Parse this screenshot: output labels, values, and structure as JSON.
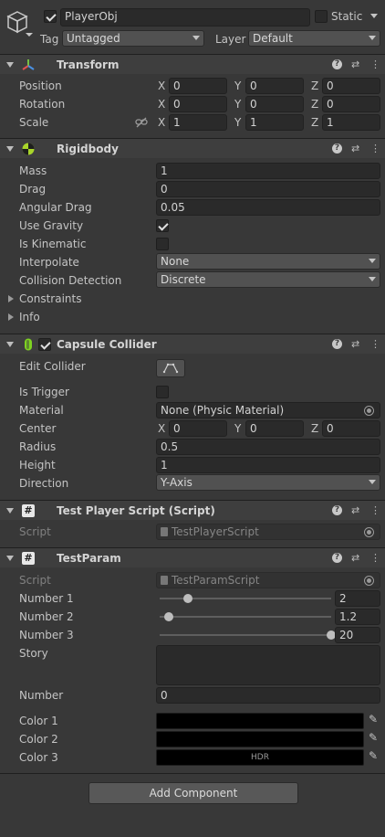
{
  "header": {
    "enabled": true,
    "object_name": "PlayerObj",
    "static_label": "Static",
    "tag_label": "Tag",
    "tag_value": "Untagged",
    "layer_label": "Layer",
    "layer_value": "Default"
  },
  "transform": {
    "title": "Transform",
    "position_label": "Position",
    "rotation_label": "Rotation",
    "scale_label": "Scale",
    "axes": [
      "X",
      "Y",
      "Z"
    ],
    "position": [
      "0",
      "0",
      "0"
    ],
    "rotation": [
      "0",
      "0",
      "0"
    ],
    "scale": [
      "1",
      "1",
      "1"
    ]
  },
  "rigidbody": {
    "title": "Rigidbody",
    "mass_label": "Mass",
    "mass": "1",
    "drag_label": "Drag",
    "drag": "0",
    "angular_drag_label": "Angular Drag",
    "angular_drag": "0.05",
    "use_gravity_label": "Use Gravity",
    "use_gravity": true,
    "is_kinematic_label": "Is Kinematic",
    "is_kinematic": false,
    "interpolate_label": "Interpolate",
    "interpolate": "None",
    "collision_label": "Collision Detection",
    "collision": "Discrete",
    "constraints_label": "Constraints",
    "info_label": "Info"
  },
  "capsule": {
    "title": "Capsule Collider",
    "enabled": true,
    "edit_label": "Edit Collider",
    "is_trigger_label": "Is Trigger",
    "is_trigger": false,
    "material_label": "Material",
    "material": "None (Physic Material)",
    "center_label": "Center",
    "axes": [
      "X",
      "Y",
      "Z"
    ],
    "center": [
      "0",
      "0",
      "0"
    ],
    "radius_label": "Radius",
    "radius": "0.5",
    "height_label": "Height",
    "height": "1",
    "direction_label": "Direction",
    "direction": "Y-Axis"
  },
  "test_player": {
    "title": "Test Player Script (Script)",
    "script_label": "Script",
    "script": "TestPlayerScript"
  },
  "test_param": {
    "title": "TestParam",
    "script_label": "Script",
    "script": "TestParamScript",
    "number1_label": "Number 1",
    "number1": "2",
    "number1_fraction": 0.14,
    "number2_label": "Number 2",
    "number2": "1.2",
    "number2_fraction": 0.03,
    "number3_label": "Number 3",
    "number3": "20",
    "number3_fraction": 1.0,
    "story_label": "Story",
    "story": "",
    "number_label": "Number",
    "number": "0",
    "color1_label": "Color 1",
    "color1": "#000000",
    "color2_label": "Color 2",
    "color2": "#000000",
    "color3_label": "Color 3",
    "color3": "#000000",
    "hdr_tag": "HDR"
  },
  "add_component": "Add Component",
  "icons": {
    "object": "cube-icon",
    "transform": "transform-axes-icon",
    "rigidbody": "rigidbody-icon",
    "capsule": "capsule-icon",
    "script": "csharp-script-icon",
    "help": "help-icon",
    "presets": "presets-icon",
    "menu": "kebab-menu-icon",
    "picker": "eyedropper-icon"
  }
}
